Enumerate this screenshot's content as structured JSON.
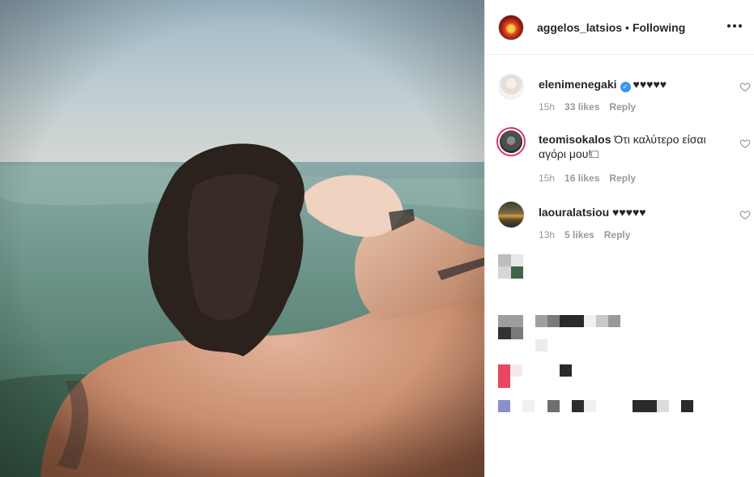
{
  "header": {
    "username": "aggelos_latsios",
    "separator": "•",
    "follow_status": "Following",
    "more_icon": "more-horizontal-icon"
  },
  "photo": {
    "description_icon": "post-photo"
  },
  "comments": [
    {
      "username": "elenimenegaki",
      "verified": true,
      "text": "♥♥♥♥♥",
      "time": "15h",
      "likes": "33 likes",
      "reply": "Reply"
    },
    {
      "username": "teomisokalos",
      "verified": false,
      "text": "Ότι καλύτερο είσαι αγόρι μου!□",
      "time": "15h",
      "likes": "16 likes",
      "reply": "Reply"
    },
    {
      "username": "laouralatsiou",
      "verified": false,
      "text": "♥♥♥♥♥",
      "time": "13h",
      "likes": "5 likes",
      "reply": "Reply"
    }
  ],
  "colors": {
    "text": "#262626",
    "muted": "#999999",
    "verified": "#3897f0",
    "story_ring": "#e1306c"
  }
}
